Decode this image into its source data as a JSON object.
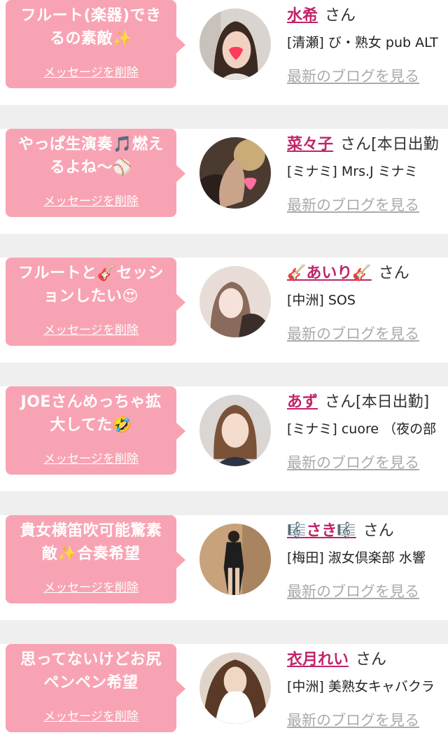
{
  "delete_label": "メッセージを削除",
  "blog_label": "最新のブログを見る",
  "san_label": "さん",
  "cards": [
    {
      "message": "フルート(楽器)でき\nるの素敵✨",
      "name": "水希",
      "status": "",
      "shop": "[清瀬] び・熟女 pub ALT"
    },
    {
      "message": "やっぱ生演奏🎵燃え\nるよね〜⚾",
      "name": "菜々子",
      "status": "[本日出勤",
      "shop": "[ミナミ] Mrs.J ミナミ"
    },
    {
      "message": "フルートと🎸セッシ\nョンしたい😍",
      "name": "🎸あいり🎸",
      "status": "",
      "shop": "[中洲] SOS"
    },
    {
      "message": "JOEさんめっちゃ拡\n大してた🤣",
      "name": "あず",
      "status": "[本日出勤]",
      "shop": "[ミナミ] cuore （夜の部"
    },
    {
      "message": "貴女横笛吹可能驚素\n敵✨合奏希望",
      "name": "🎼さき🎼",
      "status": "",
      "shop": "[梅田] 淑女倶楽部 水響"
    },
    {
      "message": "思ってないけどお尻\nペンペン希望",
      "name": "衣月れい",
      "status": "",
      "shop": "[中洲] 美熟女キャバクラ"
    }
  ]
}
